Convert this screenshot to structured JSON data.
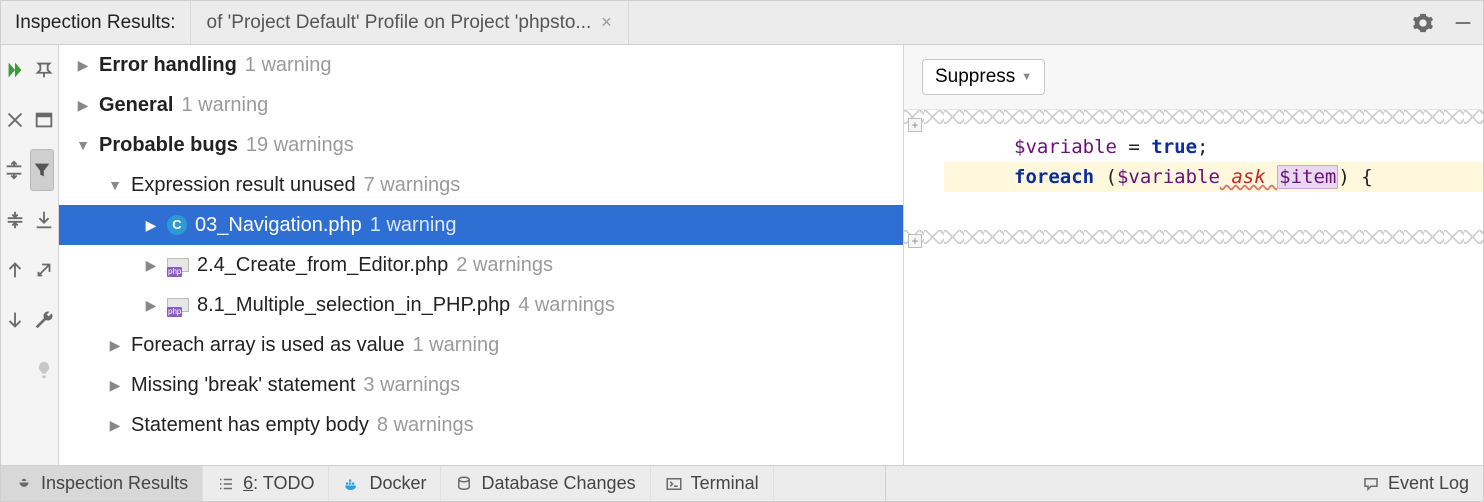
{
  "header": {
    "title": "Inspection Results:",
    "tab_label": "of 'Project Default' Profile on Project 'phpsto..."
  },
  "tree": {
    "r0": {
      "label": "Error handling",
      "count": "1 warning"
    },
    "r1": {
      "label": "General",
      "count": "1 warning"
    },
    "r2": {
      "label": "Probable bugs",
      "count": "19 warnings"
    },
    "r3": {
      "label": "Expression result unused",
      "count": "7 warnings"
    },
    "r4": {
      "label": "03_Navigation.php",
      "count": "1 warning"
    },
    "r5": {
      "label": "2.4_Create_from_Editor.php",
      "count": "2 warnings"
    },
    "r6": {
      "label": "8.1_Multiple_selection_in_PHP.php",
      "count": "4 warnings"
    },
    "r7": {
      "label": "Foreach array is used as value",
      "count": "1 warning"
    },
    "r8": {
      "label": "Missing 'break' statement",
      "count": "3 warnings"
    },
    "r9": {
      "label": "Statement has empty body",
      "count": "8 warnings"
    }
  },
  "preview": {
    "suppress_label": "Suppress",
    "code": {
      "l1": {
        "var": "$variable",
        "eq": " = ",
        "lit": "true",
        "semi": ";"
      },
      "l2": {
        "kw": "foreach",
        "open": " (",
        "v1": "$variable",
        "err": " ask ",
        "v2": "$item",
        "close": ") {"
      }
    }
  },
  "status": {
    "inspection": "Inspection Results",
    "todo_prefix": "6",
    "todo_suffix": ": TODO",
    "docker": "Docker",
    "db": "Database Changes",
    "terminal": "Terminal",
    "eventlog": "Event Log"
  }
}
